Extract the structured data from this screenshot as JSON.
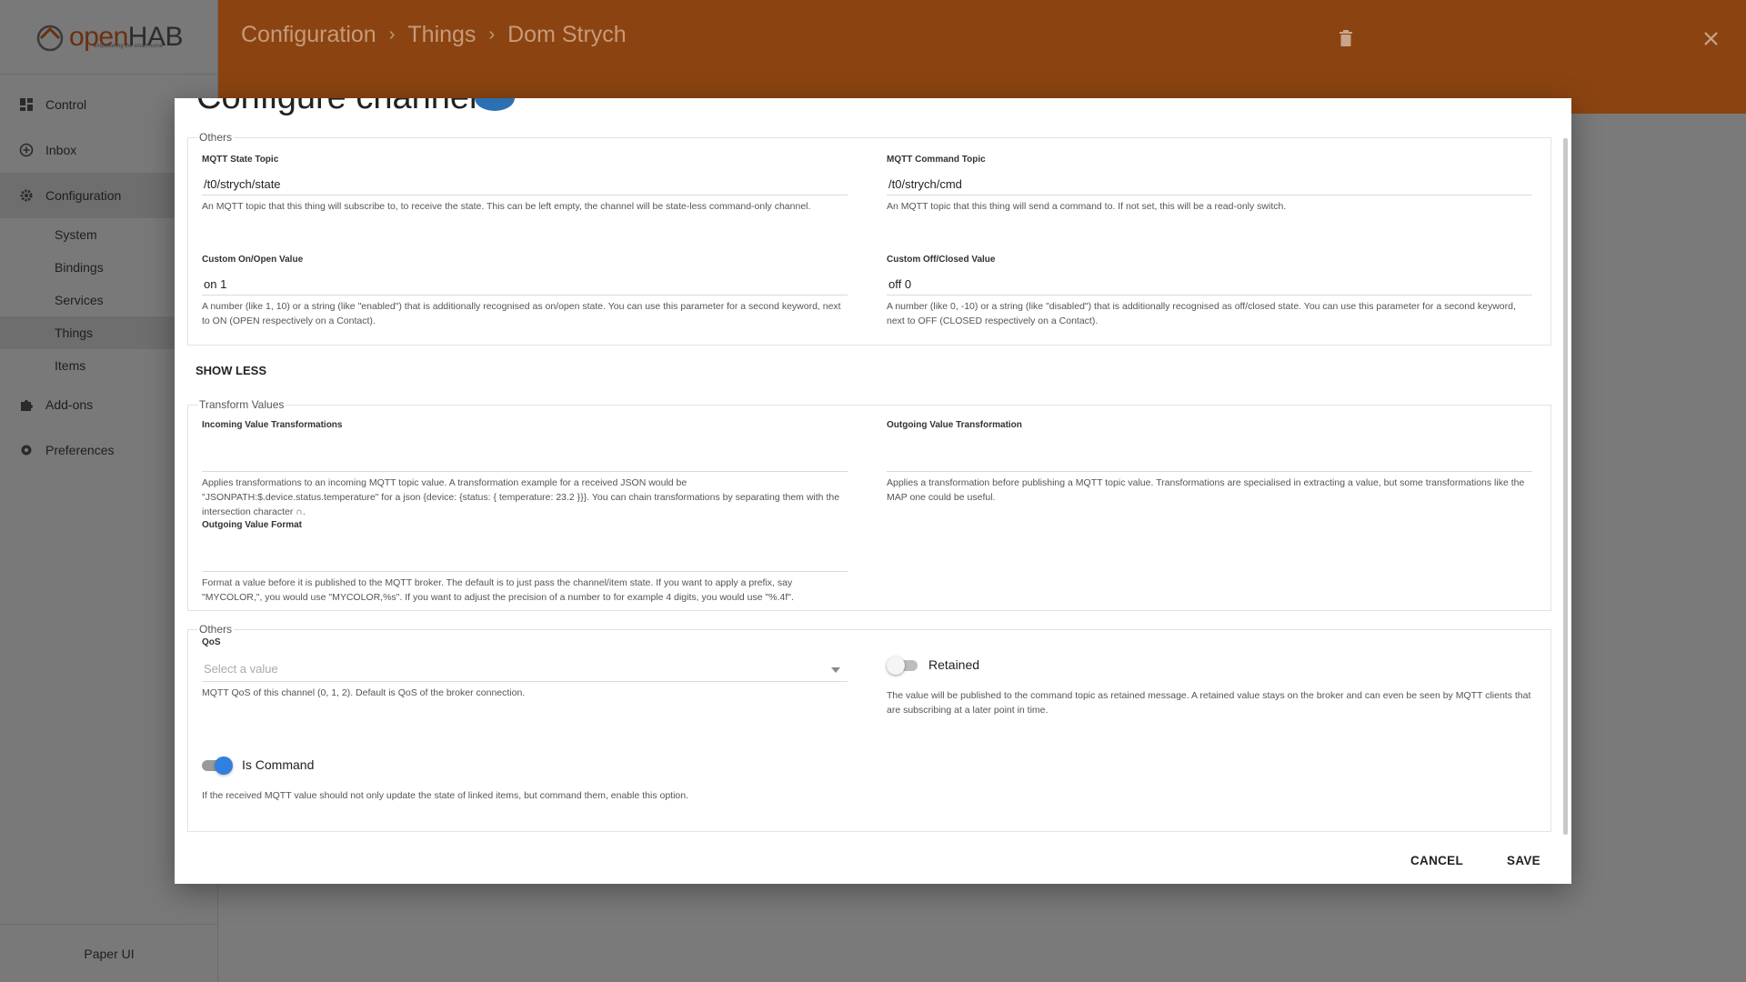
{
  "brand": {
    "name_part1": "open",
    "name_part2": "HAB",
    "tagline": "empowering the smart home"
  },
  "sidebar": {
    "items": [
      {
        "label": "Control",
        "icon": "dashboard-icon"
      },
      {
        "label": "Inbox",
        "icon": "add-circle-icon"
      },
      {
        "label": "Configuration",
        "icon": "gear-icon"
      }
    ],
    "sub_items": [
      {
        "label": "System"
      },
      {
        "label": "Bindings"
      },
      {
        "label": "Services"
      },
      {
        "label": "Things"
      },
      {
        "label": "Items"
      }
    ],
    "items_after": [
      {
        "label": "Add-ons",
        "icon": "puzzle-icon"
      },
      {
        "label": "Preferences",
        "icon": "settings-gear-icon"
      }
    ],
    "footer": "Paper UI"
  },
  "header": {
    "breadcrumb": [
      "Configuration",
      "Things",
      "Dom Strych"
    ],
    "sep": "›"
  },
  "dialog": {
    "title": "Configure channel",
    "others1": {
      "legend": "Others",
      "state_topic": {
        "label": "MQTT State Topic",
        "value": "/t0/strych/state",
        "help": "An MQTT topic that this thing will subscribe to, to receive the state. This can be left empty, the channel will be state-less command-only channel."
      },
      "command_topic": {
        "label": "MQTT Command Topic",
        "value": "/t0/strych/cmd",
        "help": "An MQTT topic that this thing will send a command to. If not set, this will be a read-only switch."
      },
      "on_value": {
        "label": "Custom On/Open Value",
        "value": "on 1",
        "help": "A number (like 1, 10) or a string (like \"enabled\") that is additionally recognised as on/open state. You can use this parameter for a second keyword, next to ON (OPEN respectively on a Contact)."
      },
      "off_value": {
        "label": "Custom Off/Closed Value",
        "value": "off 0",
        "help": "A number (like 0, -10) or a string (like \"disabled\") that is additionally recognised as off/closed state. You can use this parameter for a second keyword, next to OFF (CLOSED respectively on a Contact)."
      }
    },
    "show_less": "SHOW LESS",
    "transform": {
      "legend": "Transform Values",
      "incoming": {
        "label": "Incoming Value Transformations",
        "help": "Applies transformations to an incoming MQTT topic value. A transformation example for a received JSON would be \"JSONPATH:$.device.status.temperature\" for a json {device: {status: { temperature: 23.2 }}}. You can chain transformations by separating them with the intersection character ∩."
      },
      "outgoing": {
        "label": "Outgoing Value Transformation",
        "help": "Applies a transformation before publishing a MQTT topic value. Transformations are specialised in extracting a value, but some transformations like the MAP one could be useful."
      },
      "format": {
        "label": "Outgoing Value Format",
        "help": "Format a value before it is published to the MQTT broker. The default is to just pass the channel/item state. If you want to apply a prefix, say \"MYCOLOR,\", you would use \"MYCOLOR,%s\". If you want to adjust the precision of a number to for example 4 digits, you would use \"%.4f\"."
      }
    },
    "others2": {
      "legend": "Others",
      "qos": {
        "label": "QoS",
        "placeholder": "Select a value",
        "help": "MQTT QoS of this channel (0, 1, 2). Default is QoS of the broker connection."
      },
      "retained": {
        "label": "Retained",
        "checked": false,
        "help": "The value will be published to the command topic as retained message. A retained value stays on the broker and can even be seen by MQTT clients that are subscribing at a later point in time."
      },
      "is_command": {
        "label": "Is Command",
        "checked": true,
        "help": "If the received MQTT value should not only update the state of linked items, but command them, enable this option."
      }
    },
    "cancel": "CANCEL",
    "save": "SAVE"
  },
  "colors": {
    "header": "#8b4411",
    "accent": "#2f80e0"
  }
}
